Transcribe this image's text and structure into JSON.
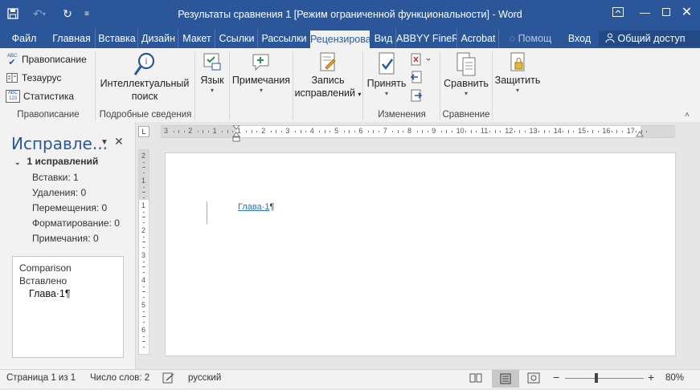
{
  "window": {
    "title": "Результаты сравнения 1 [Режим ограниченной функциональности] - Word"
  },
  "tabs": [
    {
      "label": "Файл",
      "active": false
    },
    {
      "label": "Главная",
      "active": false
    },
    {
      "label": "Вставка",
      "active": false
    },
    {
      "label": "Дизайн",
      "active": false
    },
    {
      "label": "Макет",
      "active": false
    },
    {
      "label": "Ссылки",
      "active": false
    },
    {
      "label": "Рассылки",
      "active": false
    },
    {
      "label": "Рецензирова",
      "active": true
    },
    {
      "label": "Вид",
      "active": false
    },
    {
      "label": "ABBYY FineR",
      "active": false
    },
    {
      "label": "Acrobat",
      "active": false
    }
  ],
  "tell_me": "Помощ",
  "signin": "Вход",
  "share": "Общий доступ",
  "ribbon": {
    "proofing": {
      "spelling": "Правописание",
      "thesaurus": "Тезаурус",
      "stats": "Статистика",
      "group_label": "Правописание",
      "abc": "ABC",
      "num": "123"
    },
    "insights": {
      "label_line1": "Интеллектуальный",
      "label_line2": "поиск",
      "group_label": "Подробные сведения"
    },
    "language": {
      "label": "Язык"
    },
    "comments": {
      "label": "Примечания"
    },
    "tracking": {
      "label_line1": "Запись",
      "label_line2": "исправлений"
    },
    "changes": {
      "accept": "Принять",
      "group_label": "Изменения"
    },
    "compare": {
      "label": "Сравнить",
      "group_label": "Сравнение"
    },
    "protect": {
      "label": "Защитить"
    }
  },
  "revisions_pane": {
    "title": "Исправле...",
    "summary_heading": "1 исправлений",
    "items": [
      "Вставки: 1",
      "Удаления: 0",
      "Перемещения: 0",
      "Форматирование: 0",
      "Примечания: 0"
    ],
    "revision": {
      "author": "Comparison",
      "action": "Вставлено",
      "text": "Глава·1¶"
    }
  },
  "ruler": {
    "h_ticks": [
      "3",
      "2",
      "1",
      "1",
      "2",
      "3",
      "4",
      "5",
      "6",
      "7",
      "8",
      "9",
      "10",
      "11",
      "12",
      "13",
      "14",
      "15",
      "16",
      "17"
    ],
    "v_ticks": [
      "2",
      "1",
      "1",
      "2",
      "3",
      "4",
      "5",
      "6"
    ],
    "tab_selector": "L"
  },
  "document": {
    "inserted_text": "Глава·1",
    "pilcrow": "¶"
  },
  "status": {
    "page": "Страница 1 из 1",
    "words": "Число слов: 2",
    "language": "русский",
    "zoom": "80%",
    "zoom_minus": "−",
    "zoom_plus": "+"
  },
  "colors": {
    "title_bar": "#2b579a",
    "accent": "#2b579a",
    "insert_link": "#2e74b5"
  }
}
